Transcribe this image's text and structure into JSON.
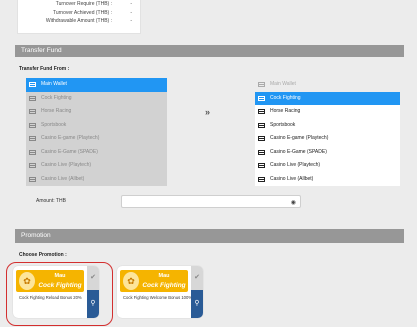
{
  "summary": {
    "rows": [
      {
        "label": "Turnover Require (THB) :",
        "value": "-"
      },
      {
        "label": "Turnover Achieved (THB) :",
        "value": "-"
      },
      {
        "label": "Withdrawable Amount (THB) :",
        "value": "-"
      }
    ]
  },
  "transfer": {
    "title": "Transfer Fund",
    "from_label": "Transfer Fund From :",
    "arrow": "»",
    "from_items": [
      "Main Wallet",
      "Cock Fighting",
      "Horse Racing",
      "Sportsbook",
      "Casino E-game (Playtech)",
      "Casino E-Game (SPADE)",
      "Casino Live (Playtech)",
      "Casino Live (Allbet)"
    ],
    "to_items": [
      "Main Wallet",
      "Cock Fighting",
      "Horse Racing",
      "Sportsbook",
      "Casino E-game (Playtech)",
      "Casino E-Game (SPADE)",
      "Casino Live (Playtech)",
      "Casino Live (Allbet)"
    ],
    "from_selected": 0,
    "to_selected": 1,
    "amount_label": "Amount: THB",
    "amount_value": ""
  },
  "promotion": {
    "title": "Promotion",
    "choose_label": "Choose Promotion :",
    "cards": [
      {
        "banner_line1": "Mau",
        "banner_line2": "Cock Fighting",
        "text": "Cock Fighting Reload Bonus 20%"
      },
      {
        "banner_line1": "Mau",
        "banner_line2": "Cock Fighting",
        "text": "Cock Fighting Welcome Bonus 100%"
      }
    ]
  },
  "colors": {
    "accent": "#2196f3",
    "section_bar": "#979797",
    "banner": "#f5b400",
    "zoom": "#2a5b96",
    "selected_ring": "#d32f2f"
  },
  "icons": {
    "list_item": "wallet-icon",
    "arrow": "double-chevron-right-icon",
    "eye": "eye-icon",
    "check": "check-icon",
    "zoom": "zoom-in-icon"
  }
}
